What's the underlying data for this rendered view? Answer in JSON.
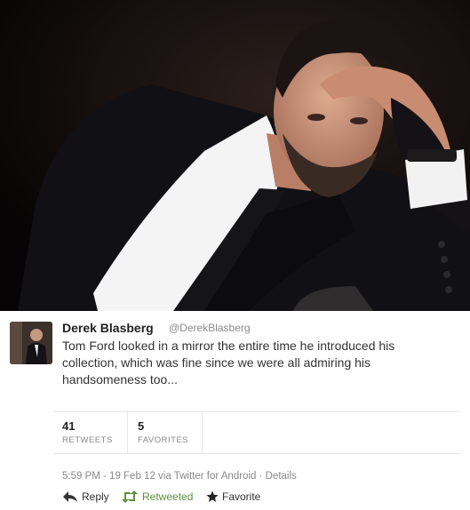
{
  "photo": {
    "icon": "portrait-photo"
  },
  "tweet": {
    "author_name": "Derek Blasberg",
    "author_handle": "@DerekBlasberg",
    "text": "Tom Ford looked in a mirror the entire time he introduced his collection, which was fine since we were all admiring his handsomeness too...",
    "retweets_count": "41",
    "retweets_label": "RETWEETS",
    "favorites_count": "5",
    "favorites_label": "FAVORITES",
    "meta": "5:59 PM - 19 Feb 12 via Twitter for Android · Details",
    "actions": {
      "reply": "Reply",
      "retweeted": "Retweeted",
      "favorite": "Favorite"
    },
    "colors": {
      "retweeted": "#5c913b",
      "meta": "#888888"
    },
    "icons": {
      "reply": "reply-arrow-icon",
      "retweet": "retweet-icon",
      "favorite": "star-icon"
    }
  }
}
